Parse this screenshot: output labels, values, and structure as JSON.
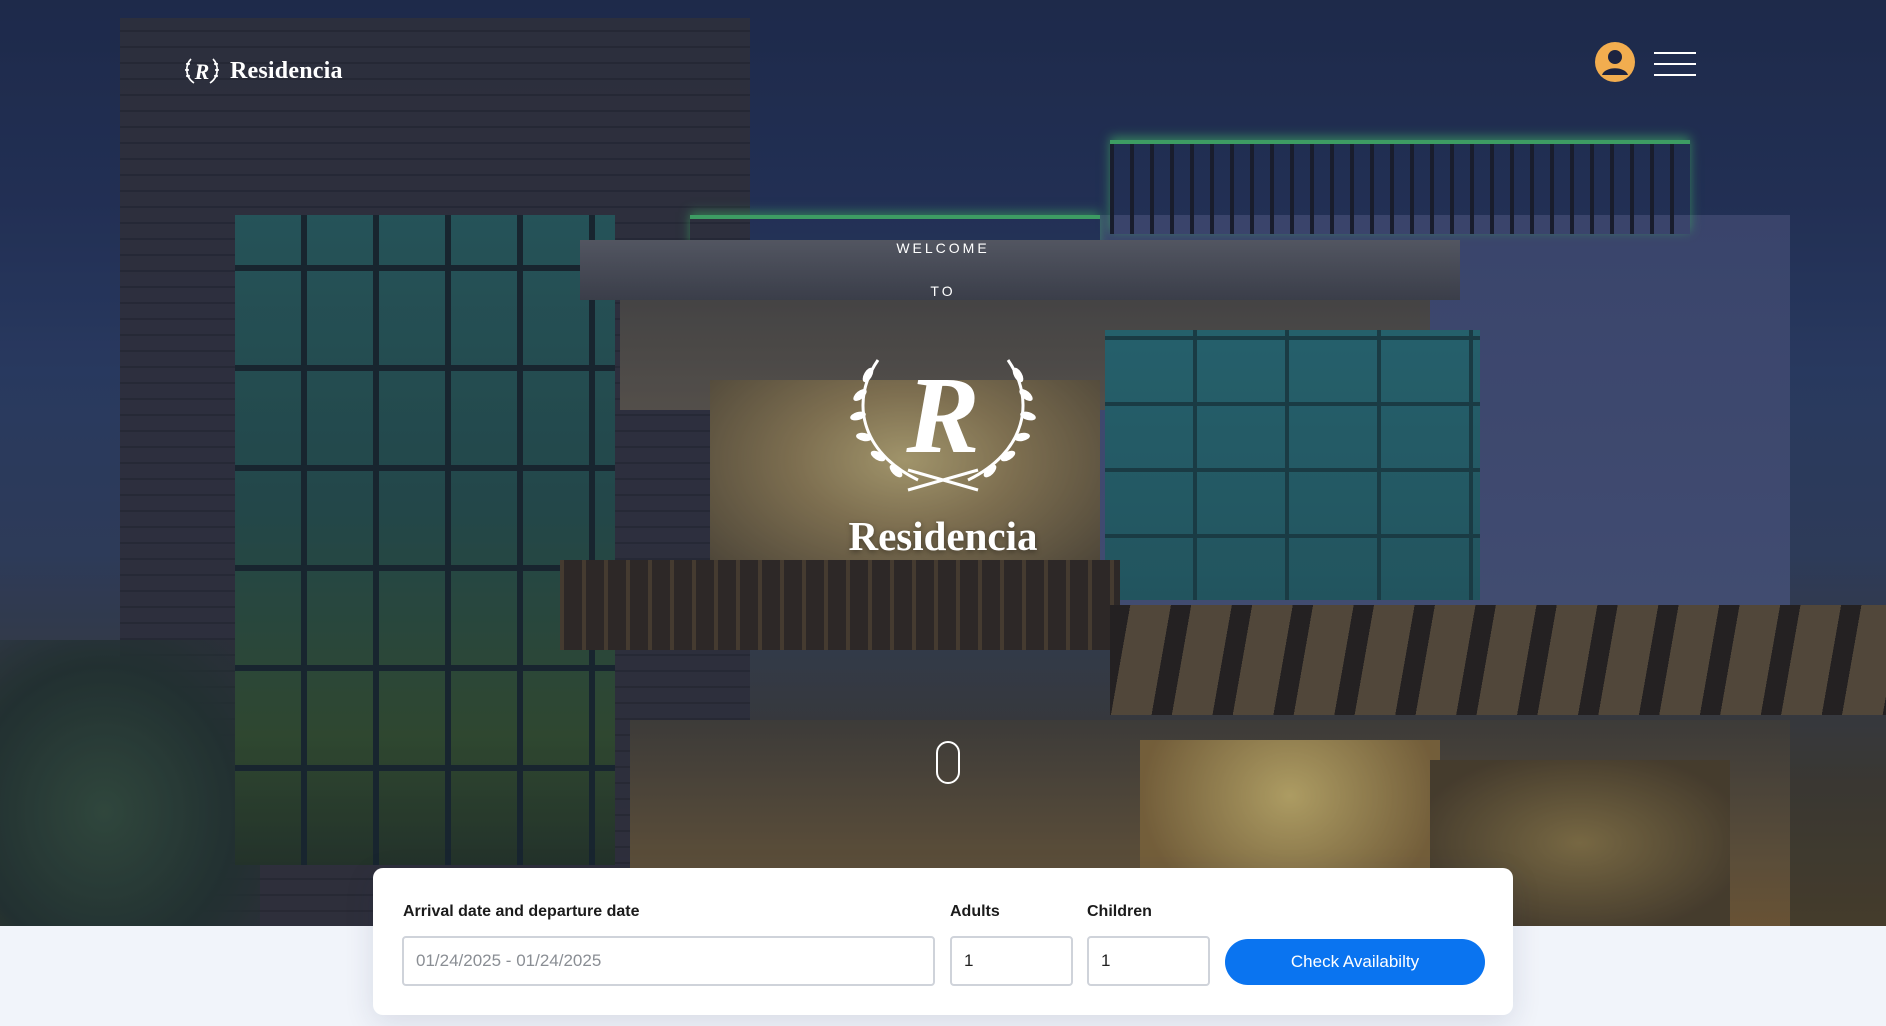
{
  "header": {
    "brand": "Residencia",
    "user_icon": "user-circle-icon",
    "menu_icon": "hamburger-menu-icon",
    "user_icon_color": "#f2ad4f"
  },
  "hero": {
    "welcome": "WELCOME",
    "to": "TO",
    "brand": "Residencia",
    "emblem_letter": "R",
    "scroll_icon": "mouse-scroll-icon"
  },
  "booking": {
    "dates_label": "Arrival date and departure date",
    "dates_value": "01/24/2025 - 01/24/2025",
    "adults_label": "Adults",
    "adults_value": "1",
    "children_label": "Children",
    "children_value": "1",
    "check_button": "Check Availabilty",
    "button_color": "#0a74f0"
  }
}
